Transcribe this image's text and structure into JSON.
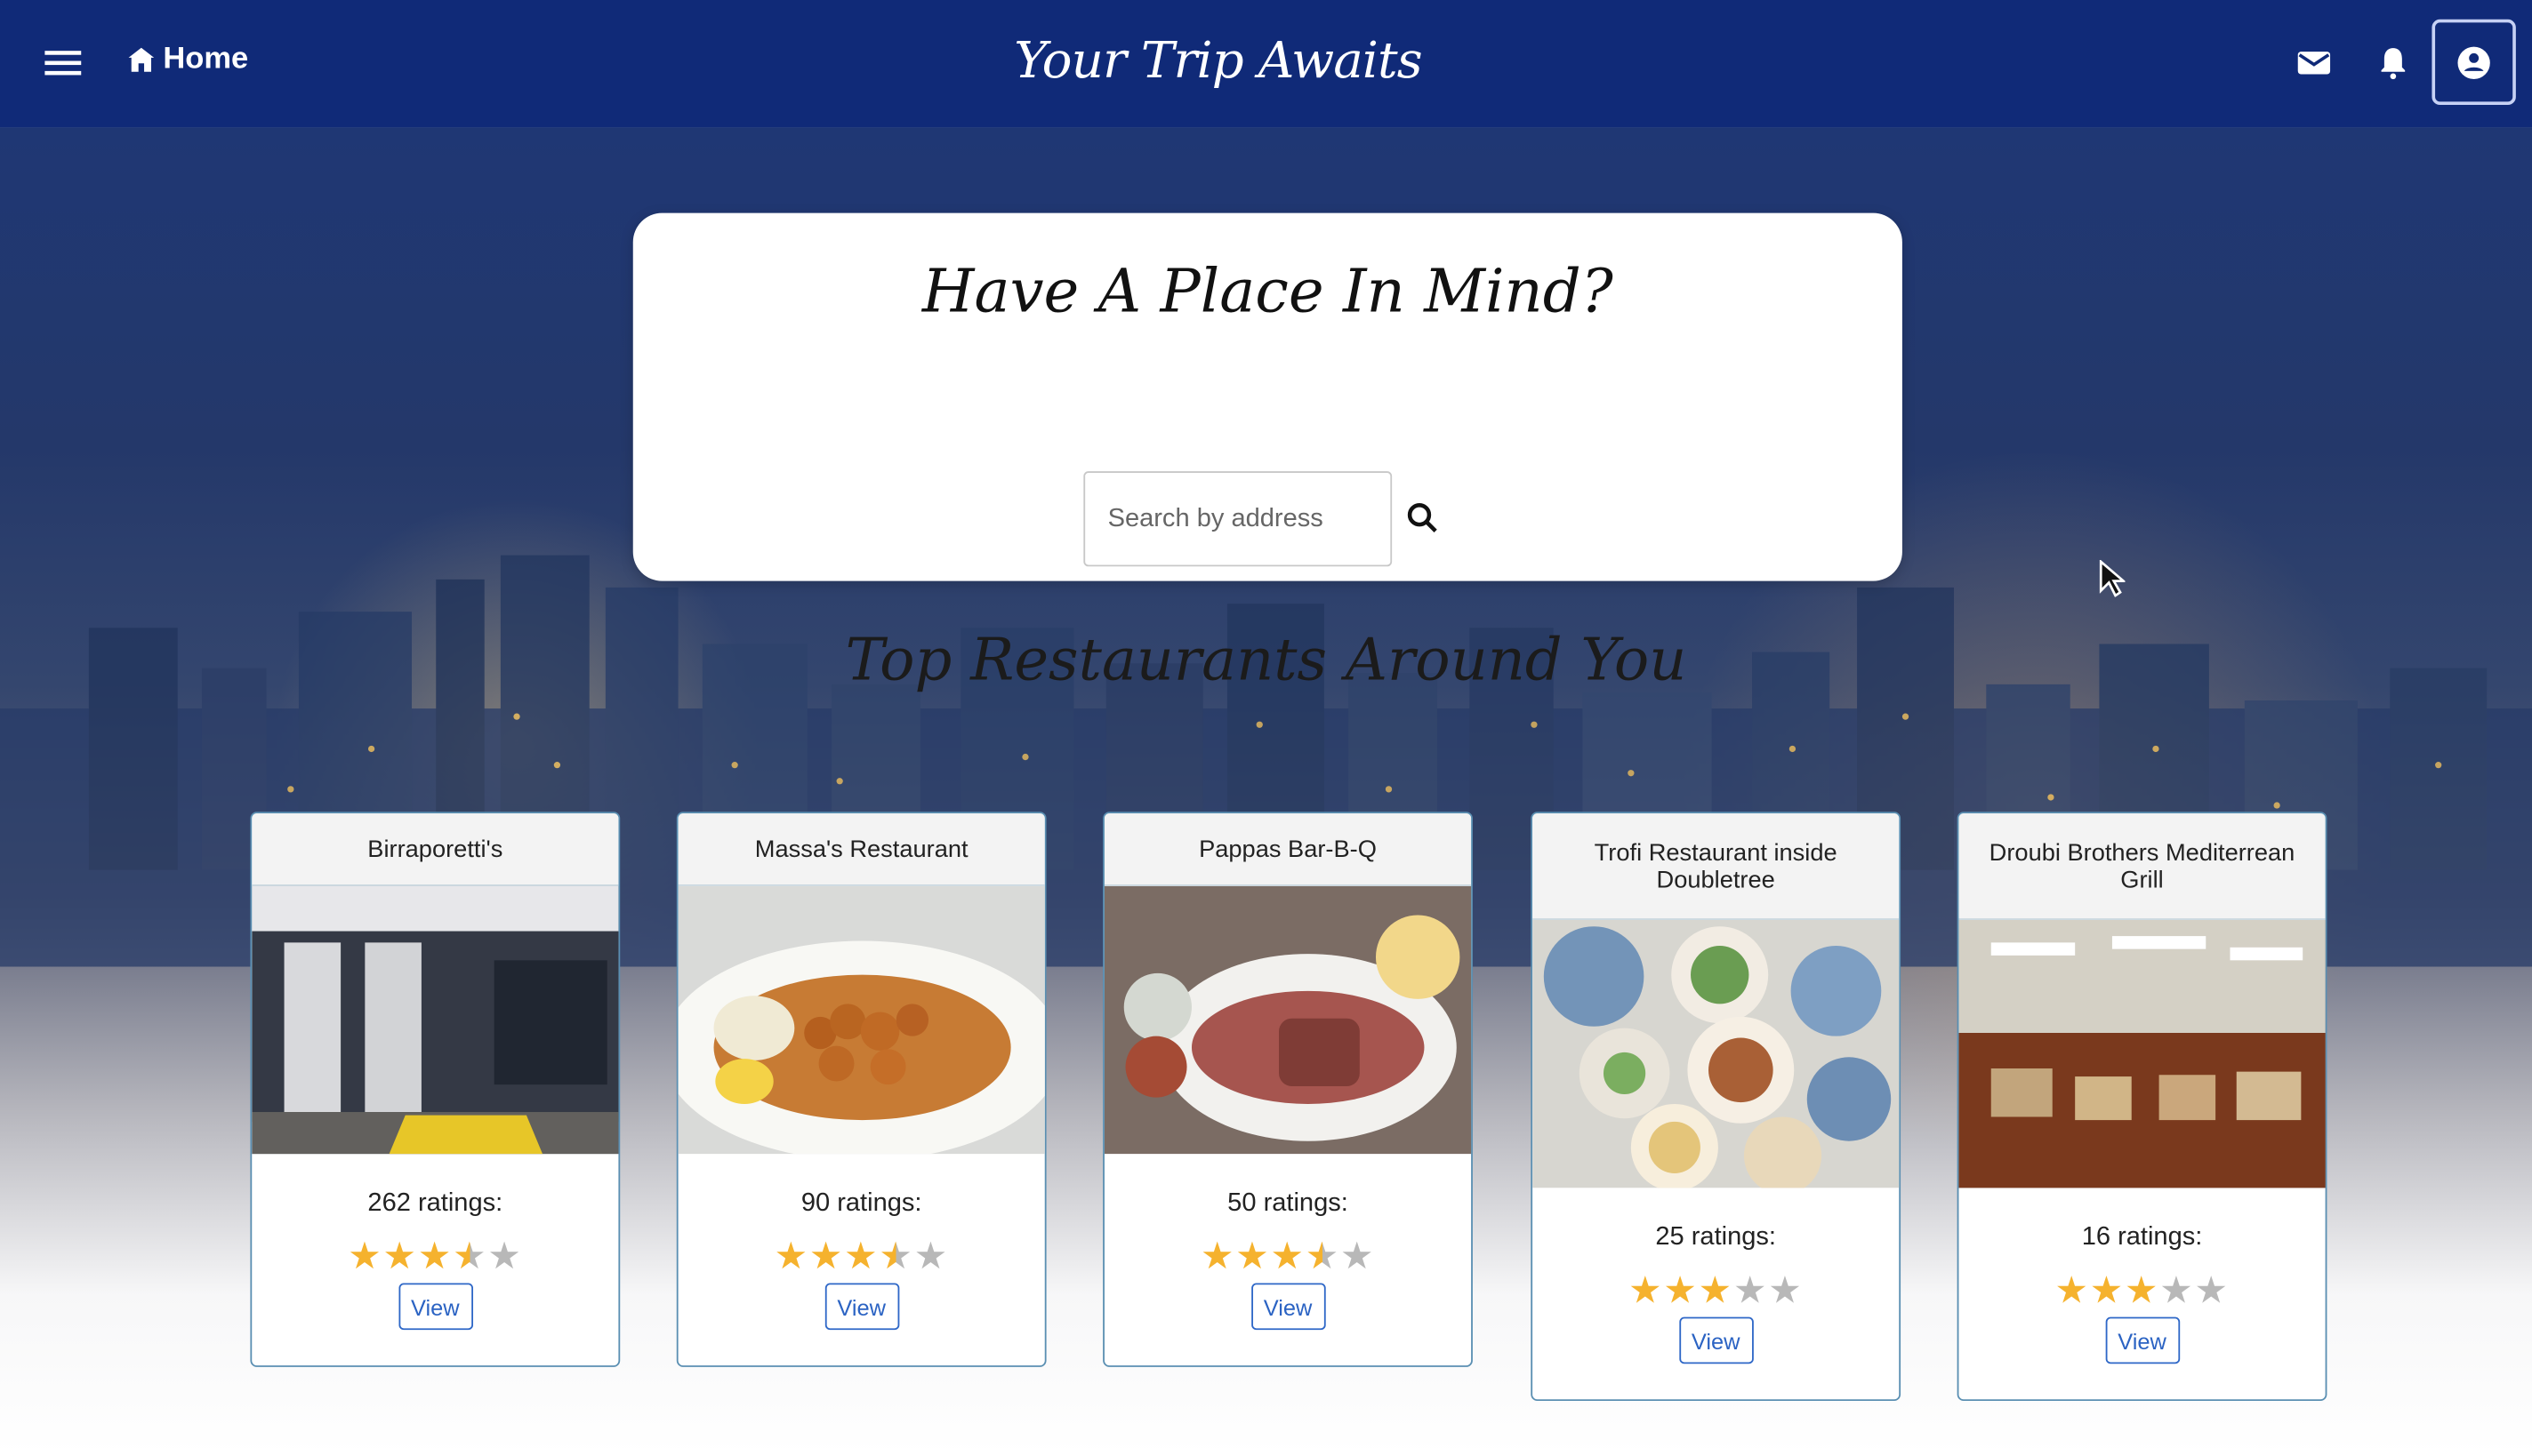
{
  "topbar": {
    "menu_icon": "menu-icon",
    "home_label": "Home",
    "brand": "Your Trip Awaits",
    "mail_icon": "mail-icon",
    "bell_icon": "bell-icon",
    "profile_icon": "profile-icon"
  },
  "search": {
    "title": "Have A Place In Mind?",
    "placeholder": "Search by address",
    "value": "",
    "icon": "search-icon"
  },
  "section_title": "Top Restaurants Around You",
  "restaurants": [
    {
      "name": "Birraporetti's",
      "ratings": "262 ratings:",
      "stars": 3.5,
      "button": "View"
    },
    {
      "name": "Massa's Restaurant",
      "ratings": "90 ratings:",
      "stars": 3.5,
      "button": "View"
    },
    {
      "name": "Pappas Bar-B-Q",
      "ratings": "50 ratings:",
      "stars": 3.5,
      "button": "View"
    },
    {
      "name": "Trofi Restaurant inside Doubletree",
      "ratings": "25 ratings:",
      "stars": 3,
      "button": "View"
    },
    {
      "name": "Droubi Brothers Mediterrean Grill",
      "ratings": "16 ratings:",
      "stars": 3,
      "button": "View"
    }
  ],
  "colors": {
    "navbar": "#102a78",
    "star": "#f5b22e",
    "button": "#2b63c3"
  }
}
